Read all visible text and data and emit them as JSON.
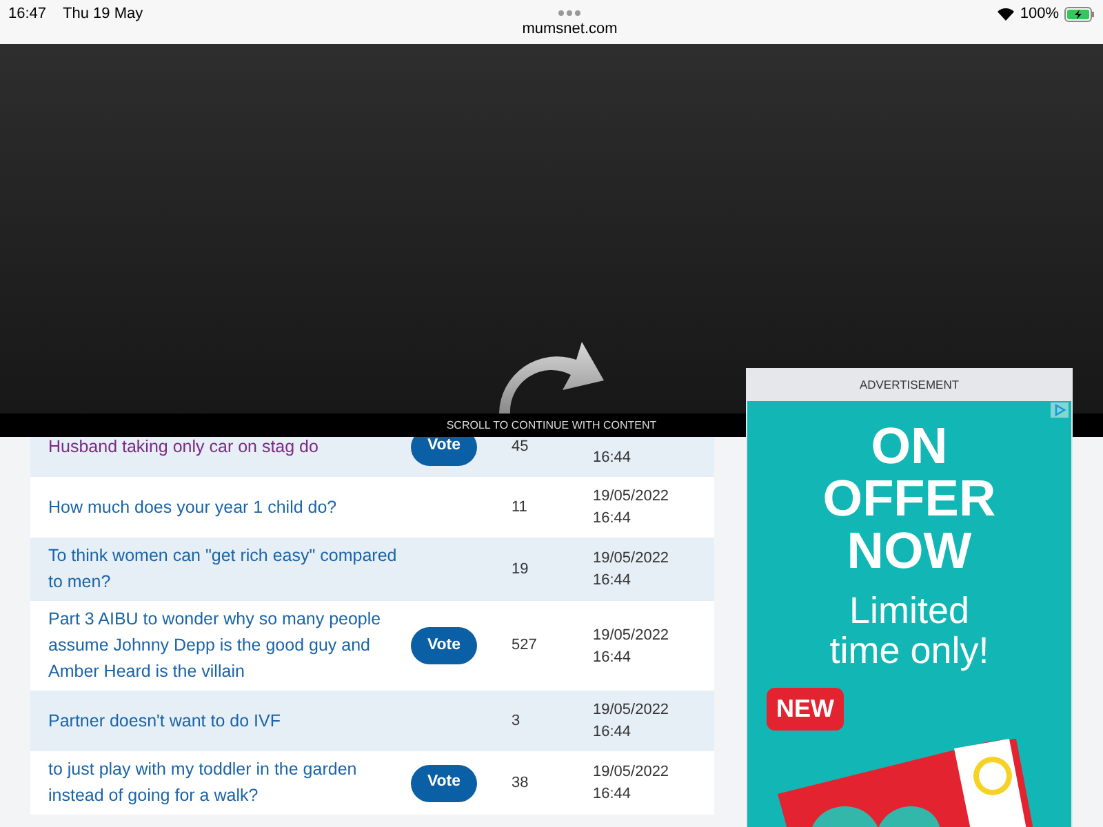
{
  "status_bar": {
    "time": "16:47",
    "date": "Thu 19 May",
    "battery": "100%",
    "url": "mumsnet.com"
  },
  "overlay": {
    "message": "SCROLL TO CONTINUE WITH CONTENT"
  },
  "threads": [
    {
      "title": "Husband taking only car on stag do",
      "visited": true,
      "vote": "Vote",
      "count": "45",
      "time": "16:44"
    },
    {
      "title": "How much does your year 1 child do?",
      "visited": false,
      "count": "11",
      "date": "19/05/2022",
      "time": "16:44"
    },
    {
      "title": "To think women can \"get rich easy\" compared to men?",
      "visited": false,
      "count": "19",
      "date": "19/05/2022",
      "time": "16:44"
    },
    {
      "title": "Part 3 AIBU to wonder why so many people assume Johnny Depp is the good guy and Amber Heard is the villain",
      "visited": false,
      "vote": "Vote",
      "count": "527",
      "date": "19/05/2022",
      "time": "16:44"
    },
    {
      "title": "Partner doesn't want to do IVF",
      "visited": false,
      "count": "3",
      "date": "19/05/2022",
      "time": "16:44"
    },
    {
      "title": "to just play with my toddler in the garden instead of going for a walk?",
      "visited": false,
      "vote": "Vote",
      "count": "38",
      "date": "19/05/2022",
      "time": "16:44"
    }
  ],
  "advert": {
    "label": "ADVERTISEMENT",
    "headline": [
      "ON",
      "OFFER",
      "NOW"
    ],
    "subline": [
      "Limited",
      "time only!"
    ],
    "badge": "NEW",
    "product": {
      "kind": "picture"
    }
  }
}
